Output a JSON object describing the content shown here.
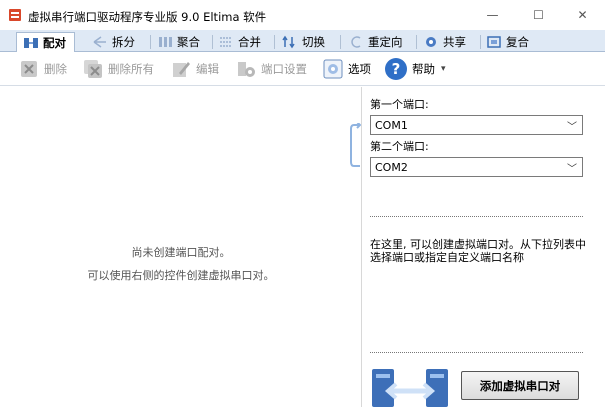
{
  "window": {
    "title": "虚拟串行端口驱动程序专业版 9.0 Eltima 软件",
    "min_glyph": "—",
    "max_glyph": "☐",
    "close_glyph": "✕"
  },
  "tabs": [
    {
      "label": "配对",
      "icon": "pair-icon",
      "active": true
    },
    {
      "label": "拆分",
      "icon": "split-icon"
    },
    {
      "label": "聚合",
      "icon": "join-icon"
    },
    {
      "label": "合并",
      "icon": "merge-icon"
    },
    {
      "label": "切换",
      "icon": "switch-icon"
    },
    {
      "label": "重定向",
      "icon": "redirect-icon"
    },
    {
      "label": "共享",
      "icon": "share-icon"
    },
    {
      "label": "复合",
      "icon": "composite-icon"
    }
  ],
  "toolbar": {
    "delete_label": "删除",
    "delete_all_label": "删除所有",
    "edit_label": "编辑",
    "port_settings_label": "端口设置",
    "options_label": "选项",
    "help_label": "帮助",
    "help_caret": "▾"
  },
  "left": {
    "empty_line1": "尚未创建端口配对。",
    "empty_line2": "可以使用右侧的控件创建虚拟串口对。"
  },
  "right": {
    "first_port_label": "第一个端口:",
    "first_port_value": "COM1",
    "second_port_label": "第二个端口:",
    "second_port_value": "COM2",
    "description": "在这里, 可以创建虚拟端口对。从下拉列表中选择端口或指定自定义端口名称",
    "add_button_label": "添加虚拟串口对"
  },
  "colors": {
    "tabstrip_bg": "#dfe9f5",
    "accent_blue": "#2f6fc7"
  }
}
